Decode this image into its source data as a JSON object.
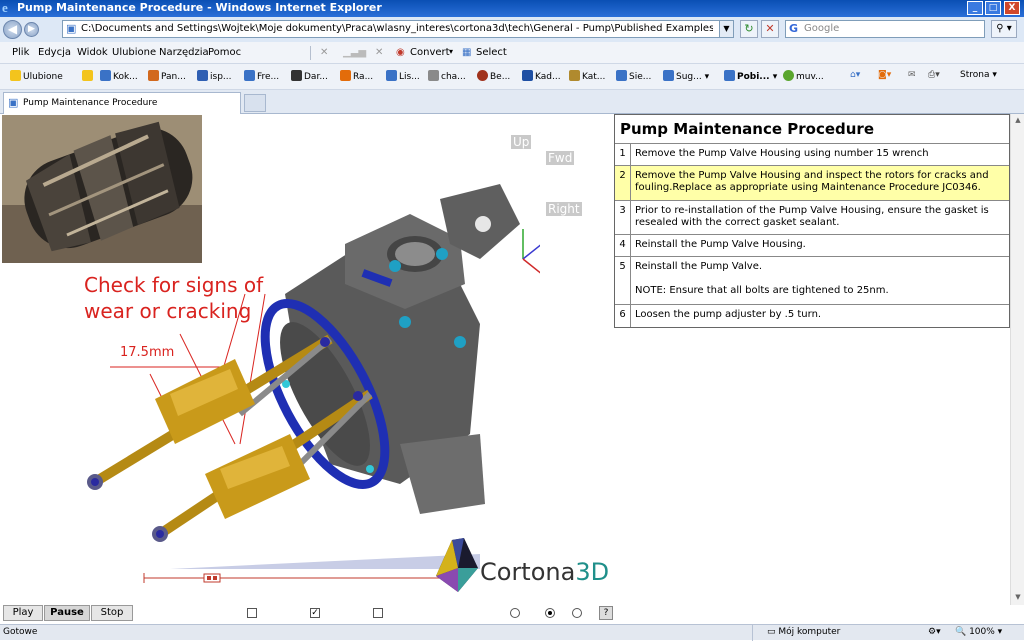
{
  "window": {
    "title": "Pump Maintenance Procedure - Windows Internet Explorer",
    "minimize": "_",
    "maximize": "□",
    "close": "X"
  },
  "address": {
    "url": "C:\\Documents and Settings\\Wojtek\\Moje dokumenty\\Praca\\wlasny_interes\\cortona3d\\tech\\General - Pump\\Published Examples\\content\\Pump Procedure - Complete.h",
    "search_placeholder": "Google"
  },
  "menu": {
    "items": [
      "Plik",
      "Edycja",
      "Widok",
      "Ulubione",
      "Narzędzia",
      "Pomoc"
    ],
    "convert": "Convert",
    "select": "Select"
  },
  "favorites": {
    "ulubione": "Ulubione",
    "items": [
      "Kok...",
      "Pan...",
      "isp...",
      "Fre...",
      "Dar...",
      "Ra...",
      "Lis...",
      "cha...",
      "Be...",
      "Kad...",
      "Kat...",
      "Sie...",
      "Sug...",
      "Pobi...",
      "muv..."
    ],
    "strona": "Strona"
  },
  "tab": {
    "title": "Pump Maintenance Procedure"
  },
  "viewer": {
    "callout_line1": "Check for signs of",
    "callout_line2": "wear or cracking",
    "dimension": "17.5mm",
    "axis_up": "Up",
    "axis_fwd": "Fwd",
    "axis_right": "Right",
    "logo_main": "Cortona",
    "logo_accent": "3D"
  },
  "procedure": {
    "title": "Pump Maintenance Procedure",
    "steps": [
      {
        "num": "1",
        "text": "Remove the Pump Valve Housing using number 15 wrench"
      },
      {
        "num": "2",
        "text": "Remove the Pump Valve Housing and inspect the rotors for cracks and fouling.Replace as appropriate using Maintenance Procedure JC0346."
      },
      {
        "num": "3",
        "text": "Prior to re-installation of the Pump Valve Housing, ensure the gasket is resealed with the correct gasket sealant."
      },
      {
        "num": "4",
        "text": "Reinstall the Pump Valve Housing."
      },
      {
        "num": "5",
        "text": "Reinstall the Pump Valve.",
        "note": "NOTE: Ensure that all bolts are tightened to 25nm."
      },
      {
        "num": "6",
        "text": "Loosen the pump adjuster by .5 turn."
      }
    ],
    "highlight_color": "#ffffa8"
  },
  "controls": {
    "play": "Play",
    "pause": "Pause",
    "stop": "Stop",
    "check2": "✓",
    "help": "?"
  },
  "status": {
    "text": "Gotowe",
    "zone": "Mój komputer",
    "zoom": "100%"
  }
}
